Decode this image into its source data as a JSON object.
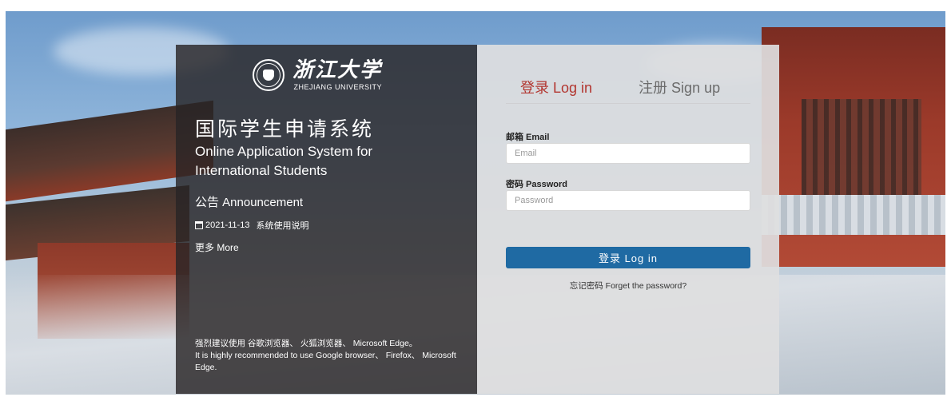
{
  "logo": {
    "name_cn": "浙江大学",
    "name_en": "ZHEJIANG UNIVERSITY"
  },
  "system": {
    "title_cn": "国际学生申请系统",
    "title_en": "Online Application System for International Students"
  },
  "announcement": {
    "title": "公告 Announcement",
    "items": [
      {
        "date": "2021-11-13",
        "text": "系统使用说明"
      }
    ],
    "more_label": "更多 More"
  },
  "browser_note": {
    "cn": "强烈建议使用 谷歌浏览器、 火狐浏览器、 Microsoft Edge。",
    "en": "It is highly recommended to use Google browser、 Firefox、 Microsoft Edge."
  },
  "login": {
    "tab_login": "登录 Log in",
    "tab_signup": "注册 Sign up",
    "email_label": "邮箱 Email",
    "email_placeholder": "Email",
    "password_label": "密码 Password",
    "password_placeholder": "Password",
    "submit_label": "登录 Log in",
    "forgot_label": "忘记密码 Forget the password?"
  },
  "colors": {
    "accent_red": "#b2352f",
    "button_blue": "#1f6aa3"
  },
  "icons": [
    "calendar-icon",
    "university-seal-icon"
  ]
}
